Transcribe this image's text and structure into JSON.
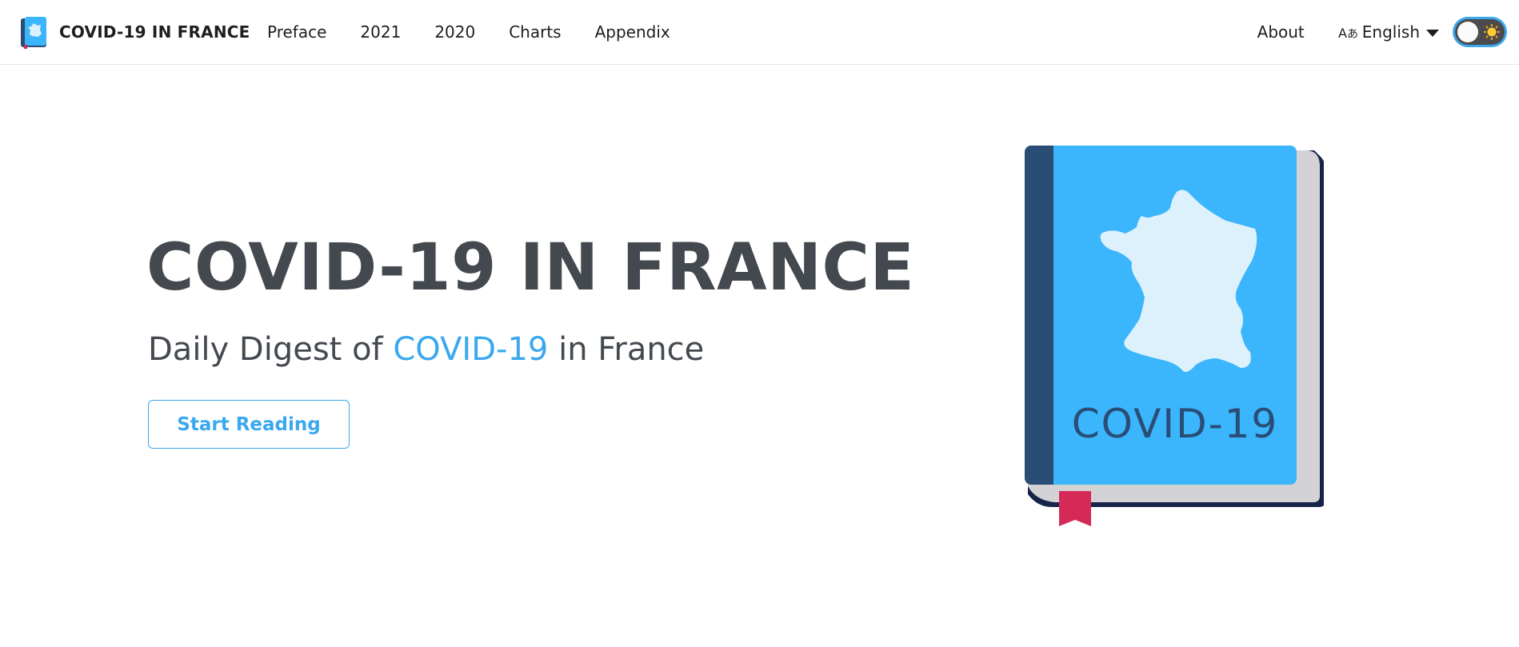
{
  "navbar": {
    "brand_title": "COVID-19 IN FRANCE",
    "brand_icon": "book-icon",
    "links": [
      "Preface",
      "2021",
      "2020",
      "Charts",
      "Appendix"
    ],
    "about": "About",
    "language": "English",
    "language_icon": "translate-icon",
    "theme_toggle_icon": "sun-icon"
  },
  "hero": {
    "title": "COVID-19 IN FRANCE",
    "subtitle_prefix": "Daily Digest of ",
    "subtitle_highlight": "COVID-19",
    "subtitle_suffix": " in France",
    "cta_label": "Start Reading",
    "illustration_text": "COVID-19"
  },
  "colors": {
    "accent": "#3aa8ef",
    "text": "#444950",
    "book_cover": "#3bb5fb",
    "book_spine": "#2a4d75",
    "bookmark": "#d52a58"
  }
}
